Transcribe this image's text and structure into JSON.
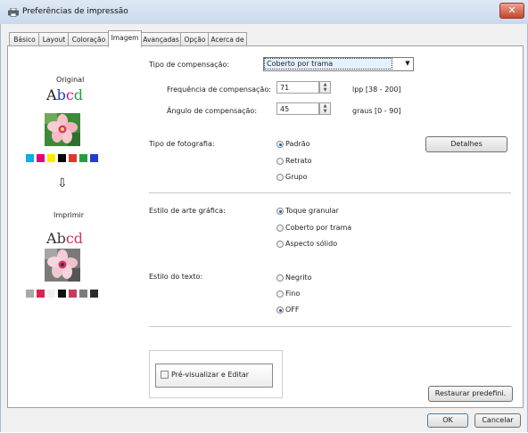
{
  "window": {
    "title": "Preferências de impressão",
    "close_glyph": "✕"
  },
  "tabs": [
    {
      "label": "Básico",
      "active": false
    },
    {
      "label": "Layout",
      "active": false
    },
    {
      "label": "Coloração",
      "active": false
    },
    {
      "label": "Imagem",
      "active": true
    },
    {
      "label": "Avançadas",
      "active": false
    },
    {
      "label": "Opção",
      "active": false
    },
    {
      "label": "Acerca de",
      "active": false
    }
  ],
  "preview": {
    "original_label": "Original",
    "original_text": "Abcd",
    "print_label": "Imprimir",
    "print_text": "Abcd",
    "arrow_glyph": "⇩",
    "original_swatches": [
      "#00b0e8",
      "#e3007f",
      "#ffe800",
      "#000000",
      "#e8352a",
      "#22a040",
      "#1d3fcf"
    ],
    "print_swatches": [
      "#a8a8a8",
      "#d9224e",
      "#f1f1f1",
      "#111111",
      "#c93a5e",
      "#7c7c7c",
      "#2b2b2b"
    ]
  },
  "compensation": {
    "type_label": "Tipo de compensação:",
    "type_value": "Coberto por trama",
    "frequency_label": "Frequência de compensação:",
    "frequency_value": "71",
    "frequency_range": "lpp [38 - 200]",
    "angle_label": "Ângulo de compensação:",
    "angle_value": "45",
    "angle_range": "graus [0 - 90]"
  },
  "photo": {
    "label": "Tipo de fotografia:",
    "options": [
      {
        "label": "Padrão",
        "selected": true
      },
      {
        "label": "Retrato",
        "selected": false
      },
      {
        "label": "Grupo",
        "selected": false
      }
    ],
    "details_button": "Detalhes"
  },
  "graphic": {
    "label": "Estilo de arte gráfica:",
    "options": [
      {
        "label": "Toque granular",
        "selected": true
      },
      {
        "label": "Coberto por trama",
        "selected": false
      },
      {
        "label": "Aspecto sólido",
        "selected": false
      }
    ]
  },
  "text_style": {
    "label": "Estilo do texto:",
    "options": [
      {
        "label": "Negrito",
        "selected": false
      },
      {
        "label": "Fino",
        "selected": false
      },
      {
        "label": "OFF",
        "selected": true
      }
    ]
  },
  "preview_edit": {
    "label": "Pré-visualizar e Editar",
    "checked": false
  },
  "buttons": {
    "restore": "Restaurar predefini.",
    "ok": "OK",
    "cancel": "Cancelar"
  }
}
